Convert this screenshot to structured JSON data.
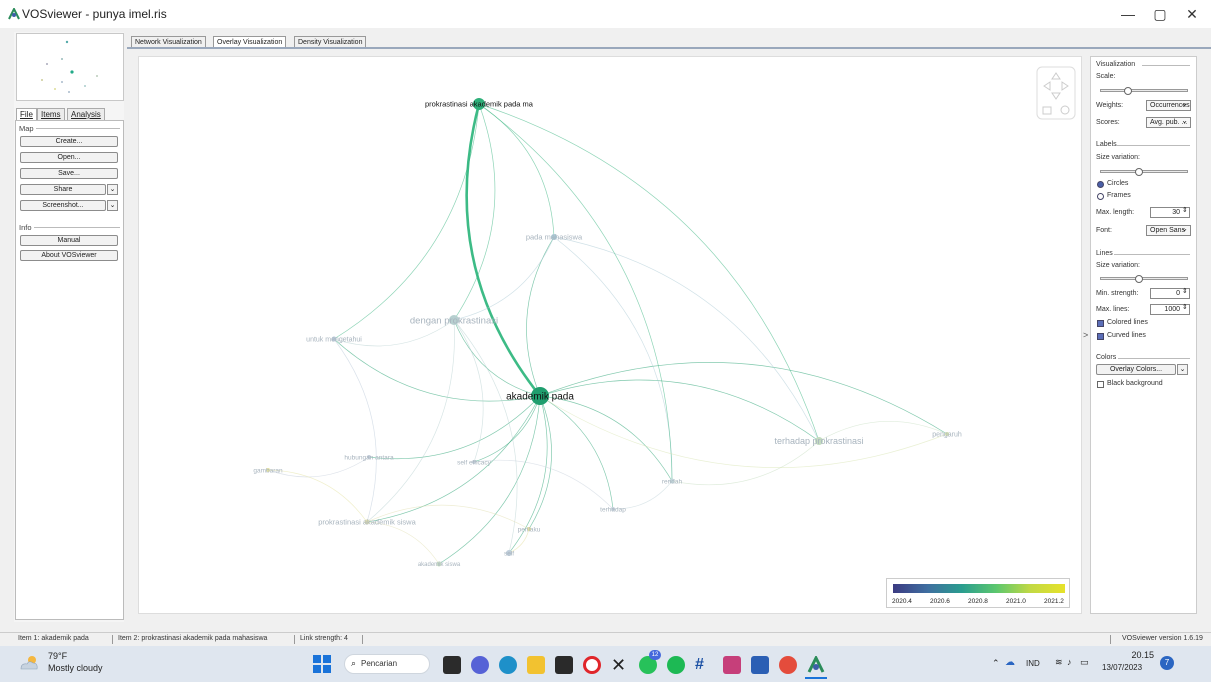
{
  "window": {
    "title": "VOSviewer - punya imel.ris",
    "minimize": "—",
    "maximize": "▢",
    "close": "✕"
  },
  "left_panel": {
    "tabs": [
      "File",
      "Items",
      "Analysis"
    ],
    "map_section": "Map",
    "buttons": {
      "create": "Create...",
      "open": "Open...",
      "save": "Save...",
      "share": "Share",
      "screenshot": "Screenshot..."
    },
    "info_section": "Info",
    "info_buttons": {
      "manual": "Manual",
      "about": "About VOSviewer"
    }
  },
  "viz_tabs": [
    "Network Visualization",
    "Overlay Visualization",
    "Density Visualization"
  ],
  "network": {
    "nodes": [
      {
        "label": "prokrastinasi akademik pada ma",
        "color": "#2fb07a",
        "strong": true
      },
      {
        "label": "pada mahasiswa",
        "color": "#a9c8d4"
      },
      {
        "label": "dengan prokrastinasi",
        "color": "#b6cfcf"
      },
      {
        "label": "untuk mengetahui",
        "color": "#b9c8d8"
      },
      {
        "label": "akademik pada",
        "color": "#1f9e6e",
        "strong": true
      },
      {
        "label": "terhadap prokrastinasi",
        "color": "#c4dcc0"
      },
      {
        "label": "pengaruh",
        "color": "#d7e3b0"
      },
      {
        "label": "hubungan antara",
        "color": "#c3ccd9"
      },
      {
        "label": "self efficacy",
        "color": "#c9d2dc"
      },
      {
        "label": "gambaran",
        "color": "#e3e1a2"
      },
      {
        "label": "rendah",
        "color": "#c2d6da"
      },
      {
        "label": "prokrastinasi akademik siswa",
        "color": "#e0deae"
      },
      {
        "label": "terhadap",
        "color": "#c6d2dc"
      },
      {
        "label": "perilaku",
        "color": "#e4de9f"
      },
      {
        "label": "self",
        "color": "#bfcdda"
      },
      {
        "label": "akademik siswa",
        "color": "#c7dcc4"
      }
    ]
  },
  "legend": {
    "ticks": [
      "2020.4",
      "2020.6",
      "2020.8",
      "2021.0",
      "2021.2"
    ]
  },
  "right_panel": {
    "visualization": "Visualization",
    "scale": "Scale:",
    "weights_label": "Weights:",
    "weights_value": "Occurrences",
    "scores_label": "Scores:",
    "scores_value": "Avg. pub. ...",
    "labels": "Labels",
    "size_variation": "Size variation:",
    "circles": "Circles",
    "frames": "Frames",
    "max_length_label": "Max. length:",
    "max_length_value": "30",
    "font_label": "Font:",
    "font_value": "Open Sans",
    "lines": "Lines",
    "lines_size_variation": "Size variation:",
    "min_strength_label": "Min. strength:",
    "min_strength_value": "0",
    "max_lines_label": "Max. lines:",
    "max_lines_value": "1000",
    "colored_lines": "Colored lines",
    "curved_lines": "Curved lines",
    "colors": "Colors",
    "overlay_colors": "Overlay Colors...",
    "black_background": "Black background"
  },
  "status": {
    "item1": "Item 1:  akademik pada",
    "item2": "Item 2:  prokrastinasi akademik pada mahasiswa",
    "link_strength": "Link strength:  4",
    "version": "VOSviewer version 1.6.19"
  },
  "taskbar": {
    "temp": "79°F",
    "weather": "Mostly cloudy",
    "search": "Pencarian",
    "lang": "IND",
    "time": "20.15",
    "date": "13/07/2023",
    "badge": "12",
    "notif": "7"
  }
}
